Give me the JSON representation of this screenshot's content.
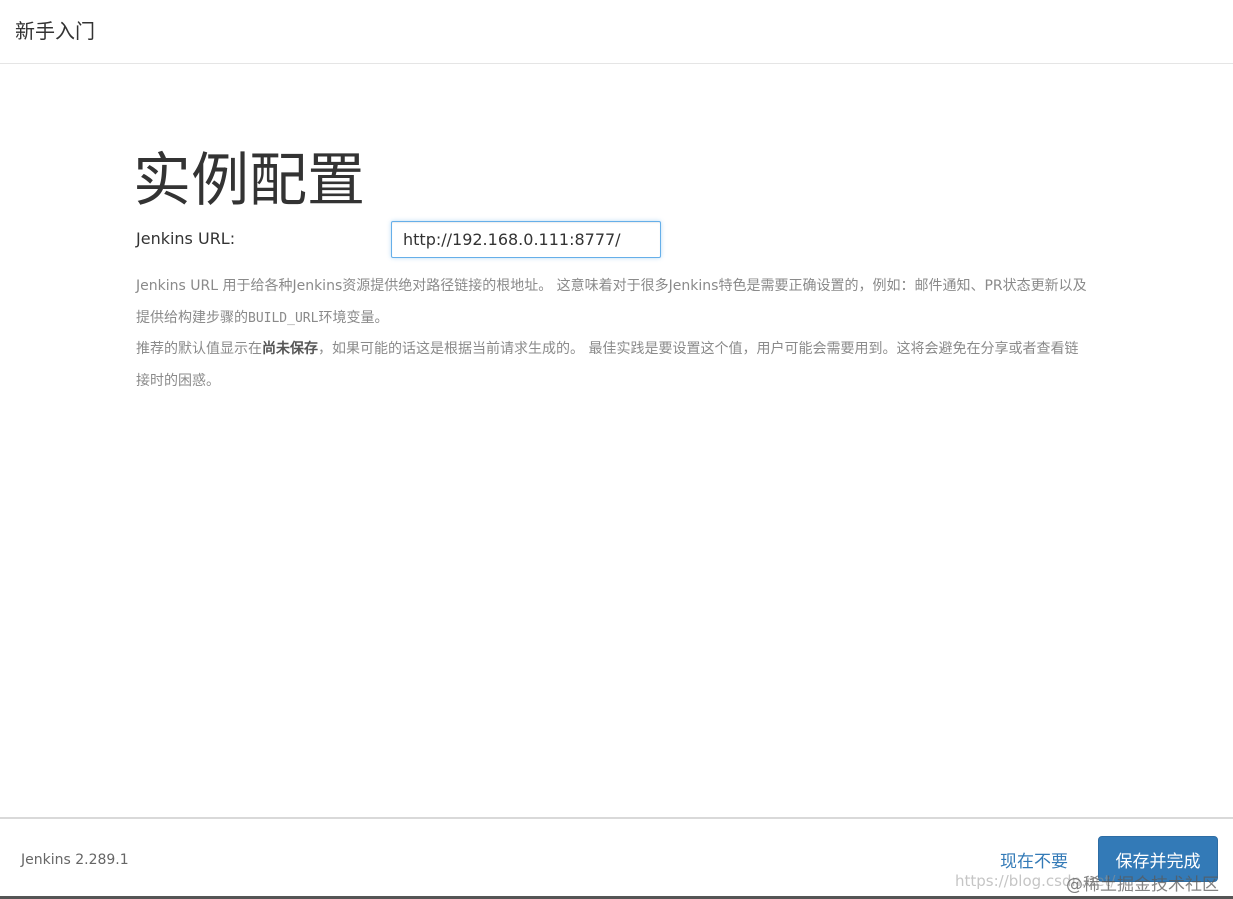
{
  "header": {
    "title": "新手入门"
  },
  "main": {
    "title": "实例配置",
    "url_label": "Jenkins URL:",
    "url_value": "http://192.168.0.111:8777/",
    "help_line1_a": "Jenkins URL 用于给各种Jenkins资源提供绝对路径链接的根地址。 这意味着对于很多Jenkins特色是需要正确设置的，例如：邮件通知、PR状态更新以及提供给构建步骤的",
    "help_line1_code": "BUILD_URL",
    "help_line1_b": "环境变量。",
    "help_line2_a": "推荐的默认值显示在",
    "help_line2_strong": "尚未保存",
    "help_line2_b": "，如果可能的话这是根据当前请求生成的。 最佳实践是要设置这个值，用户可能会需要用到。这将会避免在分享或者查看链接时的困惑。"
  },
  "footer": {
    "version": "Jenkins 2.289.1",
    "skip_label": "现在不要",
    "save_label": "保存并完成",
    "watermark_url": "https://blog.csdn.net/",
    "watermark_site": "@稀土掘金技术社区"
  },
  "colors": {
    "primary": "#337ab7",
    "link": "#337ab7",
    "help_text": "#8a8a8a",
    "input_focus_border": "#66afe9"
  }
}
